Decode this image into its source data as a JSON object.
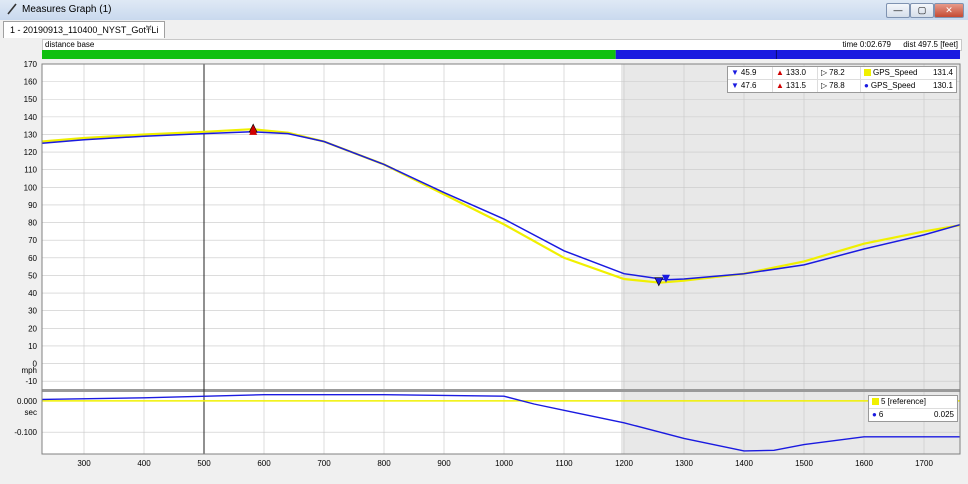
{
  "window": {
    "title": "Measures Graph (1)",
    "min_label": "—",
    "max_label": "▢",
    "close_label": "✕"
  },
  "tab": {
    "label": "1 - 20190913_110400_NYST_GotTLi",
    "close_label": "✕"
  },
  "toolbar": {
    "icons": [
      "zoom-in-icon",
      "zoom-out-icon",
      "cursor-select-icon",
      "zoom-cursor-icon",
      "zoom-fit-icon",
      "clock-icon",
      "grid-icon",
      "lap-icon",
      "triangle-icon",
      "axis-left-icon",
      "axis-step-icon",
      "axis-list-icon",
      "wrench-icon"
    ]
  },
  "status": {
    "left_label": "distance base",
    "time": "time 0:02.679",
    "dist": "dist 497.5 [feet]"
  },
  "progress": {
    "green_fraction": 0.625,
    "green_color": "#10c010",
    "blue_color": "#1a1ae0",
    "blue_marker_fraction": 0.8
  },
  "colors": {
    "yellow": "#f0f000",
    "blue": "#1a1ab8",
    "shade": "#e8e8e8"
  },
  "legend_top": {
    "rows": [
      {
        "v1": "45.9",
        "v2": "133.0",
        "v3": "78.2",
        "name": "GPS_Speed",
        "value": "131.4",
        "color": "#f0f000"
      },
      {
        "v1": "47.6",
        "v2": "131.5",
        "v3": "78.8",
        "name": "GPS_Speed",
        "value": "130.1",
        "color": "#1a1ae0"
      }
    ]
  },
  "legend_bottom": {
    "rows": [
      {
        "name": "5 [reference]",
        "value": "",
        "color": "#f0f000"
      },
      {
        "name": "6",
        "value": "0.025",
        "color": "#1a1ae0"
      }
    ]
  },
  "chart_data": [
    {
      "type": "line",
      "title": "",
      "xlabel": "",
      "ylabel": "mph",
      "xlim": [
        230,
        1760
      ],
      "ylim": [
        -15,
        170
      ],
      "xticks": [
        300,
        400,
        500,
        600,
        700,
        800,
        900,
        1000,
        1100,
        1200,
        1300,
        1400,
        1500,
        1600,
        1700
      ],
      "yticks": [
        -10,
        0,
        10,
        20,
        30,
        40,
        50,
        60,
        70,
        80,
        90,
        100,
        110,
        120,
        130,
        140,
        150,
        160,
        170
      ],
      "grid": true,
      "cursor_x": 500,
      "shaded_from_x": 1195,
      "series": [
        {
          "name": "GPS_Speed",
          "color": "#f0f000",
          "x": [
            230,
            300,
            400,
            500,
            580,
            640,
            700,
            800,
            900,
            1000,
            1100,
            1200,
            1260,
            1300,
            1400,
            1500,
            1600,
            1700,
            1760
          ],
          "y": [
            126,
            128,
            130,
            131.5,
            133,
            131,
            126,
            113,
            96,
            79,
            60,
            48,
            45.9,
            47,
            51,
            58,
            68,
            75,
            78.5
          ]
        },
        {
          "name": "GPS_Speed",
          "color": "#1a1ae0",
          "x": [
            230,
            300,
            400,
            500,
            580,
            640,
            700,
            800,
            900,
            1000,
            1100,
            1200,
            1270,
            1300,
            1400,
            1500,
            1600,
            1700,
            1760
          ],
          "y": [
            125,
            127,
            129,
            130.5,
            131.5,
            130.5,
            126,
            113,
            97,
            82,
            64,
            51,
            47.6,
            48,
            51,
            56,
            65,
            73,
            78.8
          ]
        }
      ],
      "markers": [
        {
          "series": 0,
          "x": 582,
          "y": 133.0,
          "color": "#d00000",
          "kind": "up"
        },
        {
          "series": 1,
          "x": 582,
          "y": 131.5,
          "color": "#d00000",
          "kind": "up"
        },
        {
          "series": 0,
          "x": 1258,
          "y": 45.9,
          "color": "#1a1ae0",
          "kind": "down"
        },
        {
          "series": 1,
          "x": 1270,
          "y": 47.6,
          "color": "#1a1ae0",
          "kind": "down"
        }
      ]
    },
    {
      "type": "line",
      "title": "",
      "xlabel": "",
      "ylabel": "sec",
      "xlim": [
        230,
        1760
      ],
      "ylim": [
        -0.17,
        0.035
      ],
      "yticks": [
        0.0,
        -0.1
      ],
      "ytick_labels": [
        "0.000",
        "-0.100"
      ],
      "series": [
        {
          "name": "5 [reference]",
          "color": "#f0f000",
          "x": [
            230,
            1760
          ],
          "y": [
            0,
            0
          ]
        },
        {
          "name": "6",
          "color": "#1a1ae0",
          "x": [
            230,
            400,
            600,
            800,
            1000,
            1050,
            1100,
            1200,
            1300,
            1400,
            1450,
            1500,
            1600,
            1700,
            1760
          ],
          "y": [
            0.005,
            0.01,
            0.02,
            0.02,
            0.015,
            -0.01,
            -0.03,
            -0.07,
            -0.12,
            -0.16,
            -0.158,
            -0.14,
            -0.115,
            -0.115,
            -0.115
          ]
        }
      ]
    }
  ]
}
